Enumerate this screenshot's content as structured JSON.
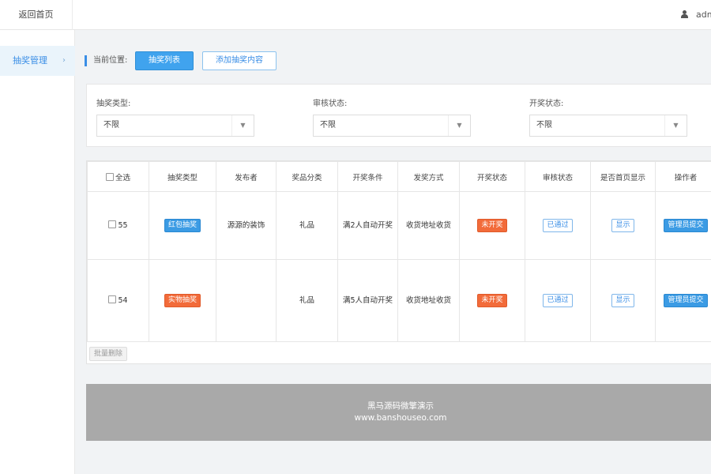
{
  "topbar": {
    "home_label": "返回首页",
    "user_label": "admin",
    "user_icon": "user-icon"
  },
  "sidebar": {
    "items": [
      {
        "label": "抽奖管理",
        "icon": "chevron-right-icon"
      }
    ]
  },
  "breadcrumb": {
    "label": "当前位置:"
  },
  "toolbar": {
    "list_button": "抽奖列表",
    "add_button": "添加抽奖内容"
  },
  "filters": [
    {
      "label": "抽奖类型:",
      "value": "不限"
    },
    {
      "label": "审核状态:",
      "value": "不限"
    },
    {
      "label": "开奖状态:",
      "value": "不限"
    }
  ],
  "table": {
    "headers": [
      "全选",
      "抽奖类型",
      "发布者",
      "奖品分类",
      "开奖条件",
      "发奖方式",
      "开奖状态",
      "审核状态",
      "是否首页显示",
      "操作者"
    ],
    "rows": [
      {
        "id": "55",
        "type": "红包抽奖",
        "publisher": "源源的装饰",
        "category": "礼品",
        "condition": "满2人自动开奖",
        "method": "收货地址收货",
        "draw_status": "未开奖",
        "review_status": "已通过",
        "home_display": "显示",
        "operator": "管理员提交"
      },
      {
        "id": "54",
        "type": "实物抽奖",
        "publisher": "",
        "category": "礼品",
        "condition": "满5人自动开奖",
        "method": "收货地址收货",
        "draw_status": "未开奖",
        "review_status": "已通过",
        "home_display": "显示",
        "operator": "管理员提交"
      }
    ],
    "batch_delete": "批量删除"
  },
  "footer": {
    "line1": "黑马源码微擎演示",
    "line2": "www.banshouseo.com"
  },
  "colors": {
    "primary": "#40a3ee",
    "orange": "#f26b3a",
    "footer_bg": "#a9a9a9"
  }
}
